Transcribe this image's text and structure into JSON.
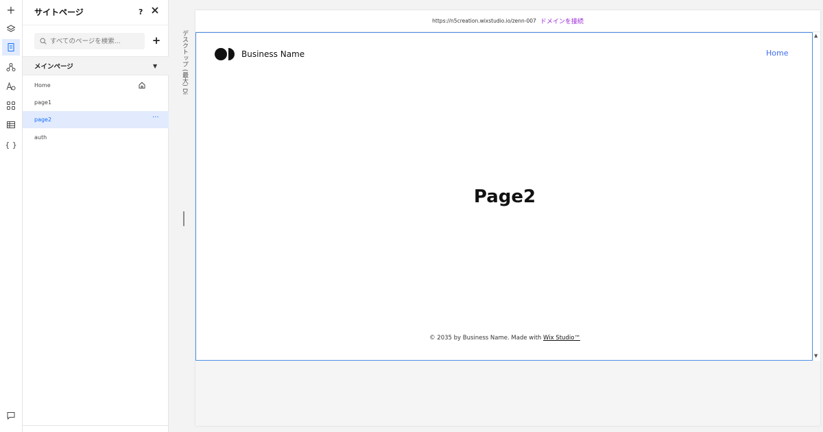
{
  "rail": {
    "add_label": "+",
    "code_label": "{ }"
  },
  "panel": {
    "title": "サイトページ",
    "help": "?",
    "search_placeholder": "すべてのページを検索...",
    "add_label": "+",
    "section_label": "メインページ",
    "pages": [
      {
        "label": "Home"
      },
      {
        "label": "page1"
      },
      {
        "label": "page2"
      },
      {
        "label": "auth"
      }
    ],
    "more_label": "···"
  },
  "device_label": "デスクトップ (最大) Di",
  "canvas": {
    "url": "https://n5creation.wixstudio.io/zenn-007",
    "connect_domain": "ドメインを接続",
    "business_name": "Business Name",
    "nav_home": "Home",
    "heading": "Page2",
    "footer_prefix": "© 2035 by Business Name. Made with ",
    "footer_link": "Wix Studio™"
  },
  "colors": {
    "accent": "#116dff",
    "selection_bg": "#e2ebfd",
    "connect_domain": "#9a27d5",
    "frame_border": "#4e8ee6",
    "nav_link": "#3b6bf0"
  },
  "icons": [
    "plus-icon",
    "layers-icon",
    "pages-icon",
    "connections-icon",
    "text-theme-icon",
    "apps-icon",
    "table-icon",
    "code-icon",
    "chat-icon",
    "search-icon",
    "close-icon",
    "home-icon",
    "caret-down-icon",
    "logo-icon"
  ]
}
